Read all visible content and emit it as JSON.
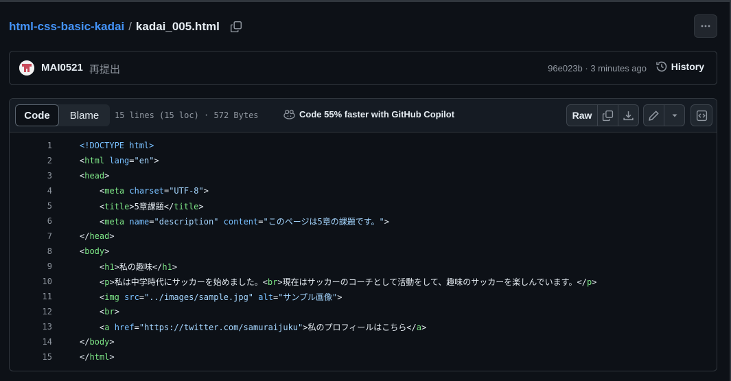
{
  "breadcrumb": {
    "repo": "html-css-basic-kadai",
    "separator": "/",
    "file": "kadai_005.html"
  },
  "commit": {
    "author": "MAI0521",
    "message": "再提出",
    "meta": "96e023b · 3 minutes ago",
    "history_label": "History"
  },
  "file_header": {
    "tab_code": "Code",
    "tab_blame": "Blame",
    "info": "15 lines (15 loc) · 572 Bytes",
    "copilot": "Code 55% faster with GitHub Copilot",
    "raw_label": "Raw"
  },
  "icons": [
    "copy-icon",
    "kebab-icon",
    "history-icon",
    "copilot-icon",
    "download-icon",
    "pencil-icon",
    "triangle-down-icon",
    "code-square-icon"
  ],
  "colors": {
    "background": "#0d1117",
    "accent_link": "#4493f8",
    "tag": "#7ee787",
    "attribute": "#79c0ff",
    "string": "#a5d6ff",
    "muted": "#9198a1"
  },
  "code_lines": [
    {
      "n": "1",
      "indent": 0,
      "tokens": [
        {
          "t": "<!DOCTYPE html>",
          "c": "dt"
        }
      ]
    },
    {
      "n": "2",
      "indent": 0,
      "tokens": [
        {
          "t": "<",
          "c": "pl"
        },
        {
          "t": "html",
          "c": "tag"
        },
        {
          "t": " ",
          "c": "pl"
        },
        {
          "t": "lang",
          "c": "at"
        },
        {
          "t": "=",
          "c": "pl"
        },
        {
          "t": "\"en\"",
          "c": "str"
        },
        {
          "t": ">",
          "c": "pl"
        }
      ]
    },
    {
      "n": "3",
      "indent": 0,
      "tokens": [
        {
          "t": "<",
          "c": "pl"
        },
        {
          "t": "head",
          "c": "tag"
        },
        {
          "t": ">",
          "c": "pl"
        }
      ]
    },
    {
      "n": "4",
      "indent": 1,
      "tokens": [
        {
          "t": "<",
          "c": "pl"
        },
        {
          "t": "meta",
          "c": "tag"
        },
        {
          "t": " ",
          "c": "pl"
        },
        {
          "t": "charset",
          "c": "at"
        },
        {
          "t": "=",
          "c": "pl"
        },
        {
          "t": "\"UTF-8\"",
          "c": "str"
        },
        {
          "t": ">",
          "c": "pl"
        }
      ]
    },
    {
      "n": "5",
      "indent": 1,
      "tokens": [
        {
          "t": "<",
          "c": "pl"
        },
        {
          "t": "title",
          "c": "tag"
        },
        {
          "t": ">5章課題</",
          "c": "pl"
        },
        {
          "t": "title",
          "c": "tag"
        },
        {
          "t": ">",
          "c": "pl"
        }
      ]
    },
    {
      "n": "6",
      "indent": 1,
      "tokens": [
        {
          "t": "<",
          "c": "pl"
        },
        {
          "t": "meta",
          "c": "tag"
        },
        {
          "t": " ",
          "c": "pl"
        },
        {
          "t": "name",
          "c": "at"
        },
        {
          "t": "=",
          "c": "pl"
        },
        {
          "t": "\"description\"",
          "c": "str"
        },
        {
          "t": " ",
          "c": "pl"
        },
        {
          "t": "content",
          "c": "at"
        },
        {
          "t": "=",
          "c": "pl"
        },
        {
          "t": "\"このページは5章の課題です。\"",
          "c": "str"
        },
        {
          "t": ">",
          "c": "pl"
        }
      ]
    },
    {
      "n": "7",
      "indent": 0,
      "tokens": [
        {
          "t": "</",
          "c": "pl"
        },
        {
          "t": "head",
          "c": "tag"
        },
        {
          "t": ">",
          "c": "pl"
        }
      ]
    },
    {
      "n": "8",
      "indent": 0,
      "tokens": [
        {
          "t": "<",
          "c": "pl"
        },
        {
          "t": "body",
          "c": "tag"
        },
        {
          "t": ">",
          "c": "pl"
        }
      ]
    },
    {
      "n": "9",
      "indent": 1,
      "tokens": [
        {
          "t": "<",
          "c": "pl"
        },
        {
          "t": "h1",
          "c": "tag"
        },
        {
          "t": ">私の趣味</",
          "c": "pl"
        },
        {
          "t": "h1",
          "c": "tag"
        },
        {
          "t": ">",
          "c": "pl"
        }
      ]
    },
    {
      "n": "10",
      "indent": 1,
      "tokens": [
        {
          "t": "<",
          "c": "pl"
        },
        {
          "t": "p",
          "c": "tag"
        },
        {
          "t": ">私は中学時代にサッカーを始めました。<",
          "c": "pl"
        },
        {
          "t": "br",
          "c": "tag"
        },
        {
          "t": ">現在はサッカーのコーチとして活動をして、趣味のサッカーを楽しんでいます。</",
          "c": "pl"
        },
        {
          "t": "p",
          "c": "tag"
        },
        {
          "t": ">",
          "c": "pl"
        }
      ]
    },
    {
      "n": "11",
      "indent": 1,
      "tokens": [
        {
          "t": "<",
          "c": "pl"
        },
        {
          "t": "img",
          "c": "tag"
        },
        {
          "t": " ",
          "c": "pl"
        },
        {
          "t": "src",
          "c": "at"
        },
        {
          "t": "=",
          "c": "pl"
        },
        {
          "t": "\"../images/sample.jpg\"",
          "c": "str"
        },
        {
          "t": " ",
          "c": "pl"
        },
        {
          "t": "alt",
          "c": "at"
        },
        {
          "t": "=",
          "c": "pl"
        },
        {
          "t": "\"サンプル画像\"",
          "c": "str"
        },
        {
          "t": ">",
          "c": "pl"
        }
      ]
    },
    {
      "n": "12",
      "indent": 1,
      "tokens": [
        {
          "t": "<",
          "c": "pl"
        },
        {
          "t": "br",
          "c": "tag"
        },
        {
          "t": ">",
          "c": "pl"
        }
      ]
    },
    {
      "n": "13",
      "indent": 1,
      "tokens": [
        {
          "t": "<",
          "c": "pl"
        },
        {
          "t": "a",
          "c": "tag"
        },
        {
          "t": " ",
          "c": "pl"
        },
        {
          "t": "href",
          "c": "at"
        },
        {
          "t": "=",
          "c": "pl"
        },
        {
          "t": "\"https://twitter.com/samuraijuku\"",
          "c": "str"
        },
        {
          "t": ">私のプロフィールはこちら</",
          "c": "pl"
        },
        {
          "t": "a",
          "c": "tag"
        },
        {
          "t": ">",
          "c": "pl"
        }
      ]
    },
    {
      "n": "14",
      "indent": 0,
      "tokens": [
        {
          "t": "</",
          "c": "pl"
        },
        {
          "t": "body",
          "c": "tag"
        },
        {
          "t": ">",
          "c": "pl"
        }
      ]
    },
    {
      "n": "15",
      "indent": 0,
      "tokens": [
        {
          "t": "</",
          "c": "pl"
        },
        {
          "t": "html",
          "c": "tag"
        },
        {
          "t": ">",
          "c": "pl"
        }
      ]
    }
  ]
}
